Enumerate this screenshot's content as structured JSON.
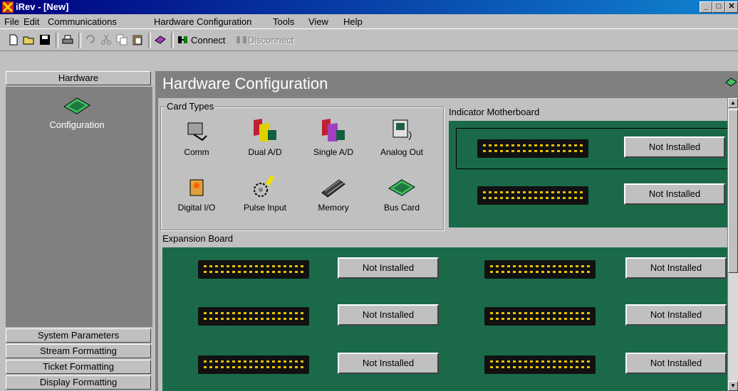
{
  "window": {
    "title": "iRev - [New]"
  },
  "menu": [
    "File",
    "Edit",
    "Communications",
    "Hardware Configuration",
    "Tools",
    "View",
    "Help"
  ],
  "toolbar": {
    "connect_label": "Connect",
    "disconnect_label": "Disconnect"
  },
  "left_nav": {
    "hardware_label": "Hardware",
    "configuration_label": "Configuration",
    "sections": [
      "System Parameters",
      "Stream Formatting",
      "Ticket Formatting",
      "Display Formatting"
    ]
  },
  "main": {
    "title": "Hardware Configuration"
  },
  "card_types": {
    "title": "Card Types",
    "items": [
      {
        "label": "Comm",
        "icon": "comm-card-icon"
      },
      {
        "label": "Dual A/D",
        "icon": "dual-ad-card-icon"
      },
      {
        "label": "Single A/D",
        "icon": "single-ad-card-icon"
      },
      {
        "label": "Analog Out",
        "icon": "analog-out-card-icon"
      },
      {
        "label": "Digital I/O",
        "icon": "digital-io-card-icon"
      },
      {
        "label": "Pulse Input",
        "icon": "pulse-input-card-icon"
      },
      {
        "label": "Memory",
        "icon": "memory-chip-icon"
      },
      {
        "label": "Bus Card",
        "icon": "bus-card-icon"
      }
    ]
  },
  "indicator_motherboard": {
    "title": "Indicator Motherboard",
    "slots": [
      {
        "status": "Not Installed"
      },
      {
        "status": "Not Installed"
      }
    ]
  },
  "expansion_board": {
    "title": "Expansion Board",
    "slots": [
      {
        "status": "Not Installed"
      },
      {
        "status": "Not Installed"
      },
      {
        "status": "Not Installed"
      },
      {
        "status": "Not Installed"
      },
      {
        "status": "Not Installed"
      },
      {
        "status": "Not Installed"
      }
    ]
  }
}
